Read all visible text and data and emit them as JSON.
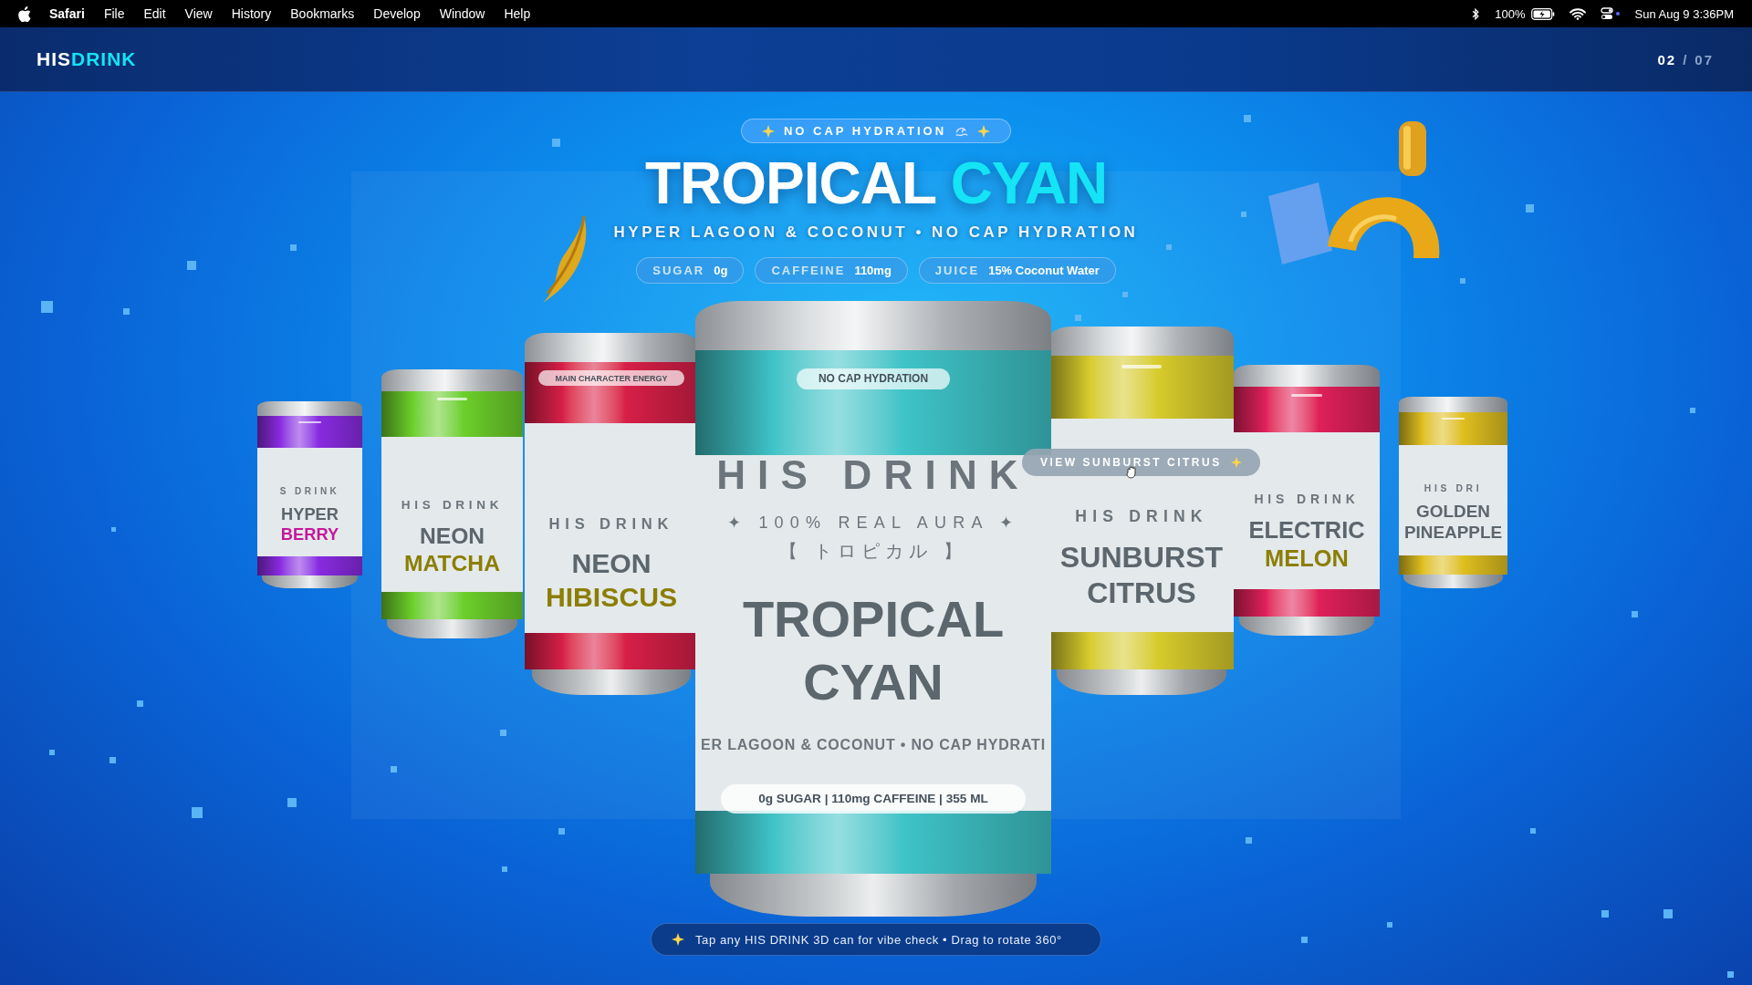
{
  "menu_bar": {
    "app": "Safari",
    "menus": [
      "File",
      "Edit",
      "View",
      "History",
      "Bookmarks",
      "Develop",
      "Window",
      "Help"
    ],
    "battery": "100%",
    "clock": "Sun Aug 9  3:36PM"
  },
  "header": {
    "logo_parts": [
      {
        "text": "HIS",
        "accent": false
      },
      {
        "text": "DRINK",
        "accent": true
      }
    ],
    "counter_current": "02",
    "counter_separator": "/",
    "counter_total": "07"
  },
  "hero": {
    "badge": "NO CAP HYDRATION",
    "title_words": [
      {
        "text": "TROPICAL",
        "accent": false
      },
      {
        "text": "CYAN",
        "accent": true
      }
    ],
    "subtitle": "HYPER LAGOON & COCONUT • NO CAP HYDRATION",
    "stats": [
      {
        "label": "SUGAR",
        "value": "0g"
      },
      {
        "label": "CAFFEINE",
        "value": "110mg"
      },
      {
        "label": "JUICE",
        "value": "15% Coconut Water"
      }
    ]
  },
  "cans": [
    {
      "kind": "side",
      "color": "#8a2be2",
      "brand": "S DRINK",
      "name_top": {
        "text": "HYPER",
        "color": "#5c666d"
      },
      "name_bottom": {
        "text": "BERRY",
        "color": "#c4189a"
      }
    },
    {
      "kind": "side",
      "color": "#6ccf2a",
      "brand": "HIS DRINK",
      "name_top": {
        "text": "NEON",
        "color": "#5c666d"
      },
      "name_bottom": {
        "text": "MATCHA",
        "color": "#8c7e00"
      }
    },
    {
      "kind": "side",
      "color": "#d81f48",
      "pill": "MAIN CHARACTER ENERGY",
      "brand": "HIS DRINK",
      "name_top": {
        "text": "NEON",
        "color": "#5c666d"
      },
      "name_bottom": {
        "text": "HIBISCUS",
        "color": "#8c7e00"
      }
    },
    {
      "kind": "main",
      "color": "#3fc4c8",
      "pill": "NO CAP HYDRATION",
      "brand": "HIS DRINK",
      "tagline": "✦ 100% REAL AURA ✦",
      "jp_name": "【 トロピカル 】",
      "name_top": {
        "text": "TROPICAL",
        "color": "#5c666d"
      },
      "name_bottom": {
        "text": "CYAN",
        "color": "#5c666d"
      },
      "flavor": "ER LAGOON & COCONUT • NO CAP HYDRATI",
      "facts": "0g SUGAR | 110mg CAFFEINE | 355 ML"
    },
    {
      "kind": "side",
      "color": "#d8cc2c",
      "brand": "HIS DRINK",
      "name_top": {
        "text": "SUNBURST",
        "color": "#5c666d"
      },
      "name_bottom": {
        "text": "CITRUS",
        "color": "#5c666d"
      }
    },
    {
      "kind": "side",
      "color": "#e0205a",
      "brand": "HIS DRINK",
      "name_top": {
        "text": "ELECTRIC",
        "color": "#5c666d"
      },
      "name_bottom": {
        "text": "MELON",
        "color": "#8c7e00"
      }
    },
    {
      "kind": "side",
      "color": "#e0c020",
      "brand": "HIS DRI",
      "name_top": {
        "text": "GOLDEN",
        "color": "#5c666d"
      },
      "name_bottom": {
        "text": "PINEAPPLE",
        "color": "#5c666d"
      }
    }
  ],
  "tooltip": "VIEW SUNBURST CITRUS",
  "hint": "Tap any HIS DRINK 3D can for vibe check • Drag to rotate 360°"
}
